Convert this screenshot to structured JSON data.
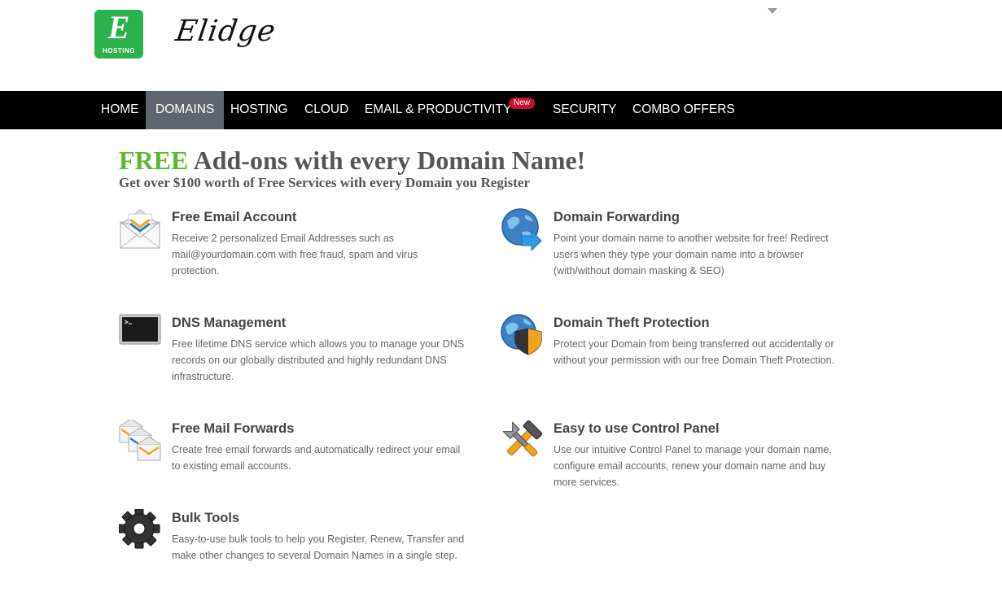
{
  "brand": {
    "logo_letter": "E",
    "logo_subtext": "HOSTING",
    "name": "Elidge",
    "logo_color": "#2bb24c"
  },
  "nav": {
    "items": [
      {
        "label": "HOME"
      },
      {
        "label": "DOMAINS",
        "active": true
      },
      {
        "label": "HOSTING"
      },
      {
        "label": "CLOUD"
      },
      {
        "label": "EMAIL & PRODUCTIVITY"
      },
      {
        "label": "SECURITY"
      },
      {
        "label": "COMBO OFFERS"
      }
    ],
    "new_badge": "New"
  },
  "hero": {
    "highlight": "FREE",
    "title_rest": " Add-ons with every Domain Name!",
    "subtitle": "Get over $100 worth of Free Services with every Domain you Register",
    "highlight_color": "#5cb82e"
  },
  "features": [
    {
      "icon": "envelope-icon",
      "title": "Free Email Account",
      "desc": "Receive 2 personalized Email Addresses such as mail@yourdomain.com with free fraud, spam and virus protection."
    },
    {
      "icon": "globe-arrow-icon",
      "title": "Domain Forwarding",
      "desc": "Point your domain name to another website for free! Redirect users when they type your domain name into a browser (with/without domain masking & SEO)"
    },
    {
      "icon": "terminal-icon",
      "title": "DNS Management",
      "desc": "Free lifetime DNS service which allows you to manage your DNS records on our globally distributed and highly redundant DNS infrastructure."
    },
    {
      "icon": "globe-shield-icon",
      "title": "Domain Theft Protection",
      "desc": "Protect your Domain from being transferred out accidentally or without your permission with our free Domain Theft Protection."
    },
    {
      "icon": "stacked-envelopes-icon",
      "title": "Free Mail Forwards",
      "desc": "Create free email forwards and automatically redirect your email to existing email accounts."
    },
    {
      "icon": "tools-icon",
      "title": "Easy to use Control Panel",
      "desc": "Use our intuitive Control Panel to manage your domain name, configure email accounts, renew your domain name and buy more services."
    },
    {
      "icon": "gear-icon",
      "title": "Bulk Tools",
      "desc": "Easy-to-use bulk tools to help you Register, Renew, Transfer and make other changes to several Domain Names in a single step."
    }
  ]
}
